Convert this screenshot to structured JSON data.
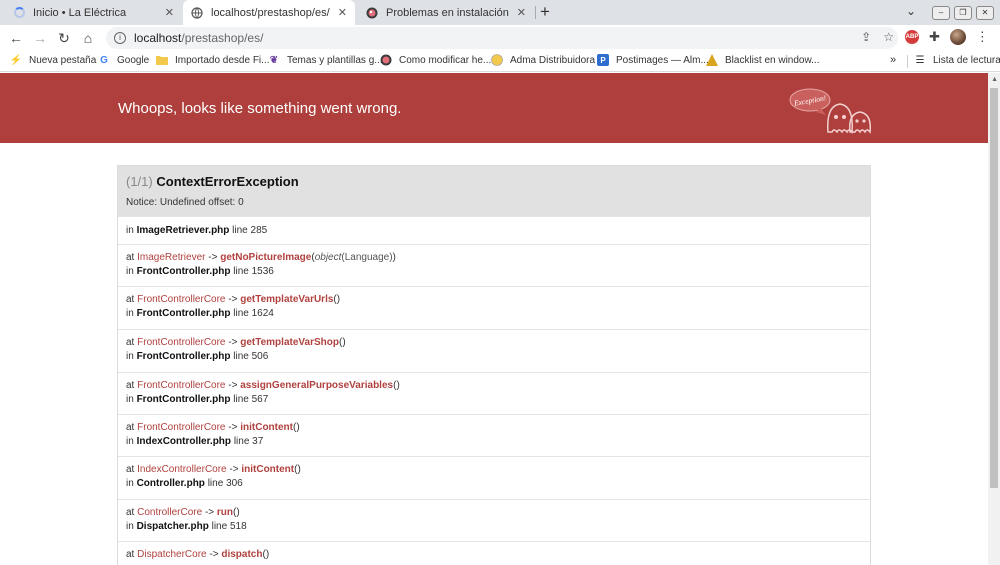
{
  "tabs": [
    {
      "title": "Inicio • La Eléctrica",
      "active": false
    },
    {
      "title": "localhost/prestashop/es/",
      "active": true
    },
    {
      "title": "Problemas en instalación de Tem",
      "active": false
    }
  ],
  "toolbar": {
    "url_host": "localhost",
    "url_path": "/prestashop/es/",
    "abp_label": "ABP"
  },
  "bookmarks": [
    {
      "label": "Nueva pestaña",
      "icon": "lightning-icon"
    },
    {
      "label": "Google",
      "icon": "google-icon"
    },
    {
      "label": "Importado desde Fi...",
      "icon": "folder-icon"
    },
    {
      "label": "Temas y plantillas g...",
      "icon": "themes-icon"
    },
    {
      "label": "Como modificar he...",
      "icon": "globe-icon"
    },
    {
      "label": "Adma Distribuidora",
      "icon": "adma-icon"
    },
    {
      "label": "Postimages — Alm...",
      "icon": "postimages-icon"
    },
    {
      "label": "Blacklist en window...",
      "icon": "blacklist-icon"
    }
  ],
  "reading_list": "Lista de lectura",
  "more_bookmarks": "»",
  "banner": {
    "title": "Whoops, looks like something went wrong.",
    "ghost_label": "Exception!"
  },
  "exception": {
    "count": "(1/1)",
    "name": "ContextErrorException",
    "message": "Notice: Undefined offset: 0"
  },
  "trace": [
    {
      "in_prefix": "in",
      "file": "ImageRetriever.php",
      "line_word": "line",
      "line": "285"
    },
    {
      "at": "at",
      "cls": "ImageRetriever",
      "arrow": "->",
      "fn": "getNoPictureImage",
      "args_open": "(",
      "arg_type": "object",
      "arg_val": "(Language)",
      "args_close": ")",
      "in_prefix": "in",
      "file": "FrontController.php",
      "line_word": "line",
      "line": "1536"
    },
    {
      "at": "at",
      "cls": "FrontControllerCore",
      "arrow": "->",
      "fn": "getTemplateVarUrls",
      "args_open": "(",
      "args_close": ")",
      "in_prefix": "in",
      "file": "FrontController.php",
      "line_word": "line",
      "line": "1624"
    },
    {
      "at": "at",
      "cls": "FrontControllerCore",
      "arrow": "->",
      "fn": "getTemplateVarShop",
      "args_open": "(",
      "args_close": ")",
      "in_prefix": "in",
      "file": "FrontController.php",
      "line_word": "line",
      "line": "506"
    },
    {
      "at": "at",
      "cls": "FrontControllerCore",
      "arrow": "->",
      "fn": "assignGeneralPurposeVariables",
      "args_open": "(",
      "args_close": ")",
      "in_prefix": "in",
      "file": "FrontController.php",
      "line_word": "line",
      "line": "567"
    },
    {
      "at": "at",
      "cls": "FrontControllerCore",
      "arrow": "->",
      "fn": "initContent",
      "args_open": "(",
      "args_close": ")",
      "in_prefix": "in",
      "file": "IndexController.php",
      "line_word": "line",
      "line": "37"
    },
    {
      "at": "at",
      "cls": "IndexControllerCore",
      "arrow": "->",
      "fn": "initContent",
      "args_open": "(",
      "args_close": ")",
      "in_prefix": "in",
      "file": "Controller.php",
      "line_word": "line",
      "line": "306"
    },
    {
      "at": "at",
      "cls": "ControllerCore",
      "arrow": "->",
      "fn": "run",
      "args_open": "(",
      "args_close": ")",
      "in_prefix": "in",
      "file": "Dispatcher.php",
      "line_word": "line",
      "line": "518"
    },
    {
      "at": "at",
      "cls": "DispatcherCore",
      "arrow": "->",
      "fn": "dispatch",
      "args_open": "(",
      "args_close": ")"
    }
  ],
  "colors": {
    "banner": "#ae3f3c",
    "link": "#b0413e",
    "header_bg": "#e1e1e1"
  }
}
